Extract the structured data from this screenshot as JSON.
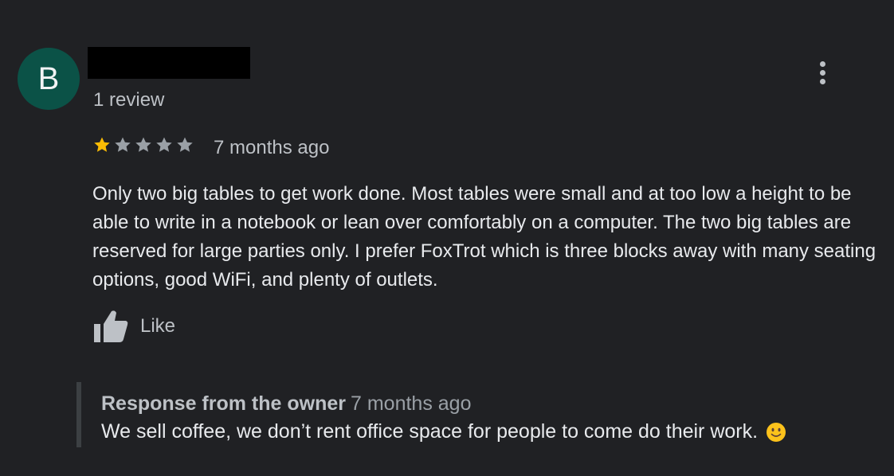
{
  "review": {
    "avatar_letter": "B",
    "review_count": "1 review",
    "rating": 1,
    "max_rating": 5,
    "date": "7 months ago",
    "text": "Only two big tables to get work done. Most tables were small and at too low a height to be able to write in a notebook or lean over comfortably on a computer. The two big tables are reserved for large parties only. I prefer FoxTrot which is three blocks away with many seating options, good WiFi, and plenty of outlets.",
    "like_label": "Like"
  },
  "owner_response": {
    "title": "Response from the owner",
    "date": "7 months ago",
    "text": "We sell coffee, we don’t rent office space for people to come do their work."
  },
  "icons": {
    "avatar": "avatar",
    "more": "more-vert-icon",
    "star": "star-icon",
    "like": "thumbs-up-icon",
    "emoji": "slightly-smiling-face-icon"
  },
  "colors": {
    "background": "#202124",
    "avatar": "#0b5247",
    "star_filled": "#fbbc04",
    "star_empty": "#9aa0a6",
    "text_primary": "#e8eaed",
    "text_secondary": "#bdc1c6"
  }
}
